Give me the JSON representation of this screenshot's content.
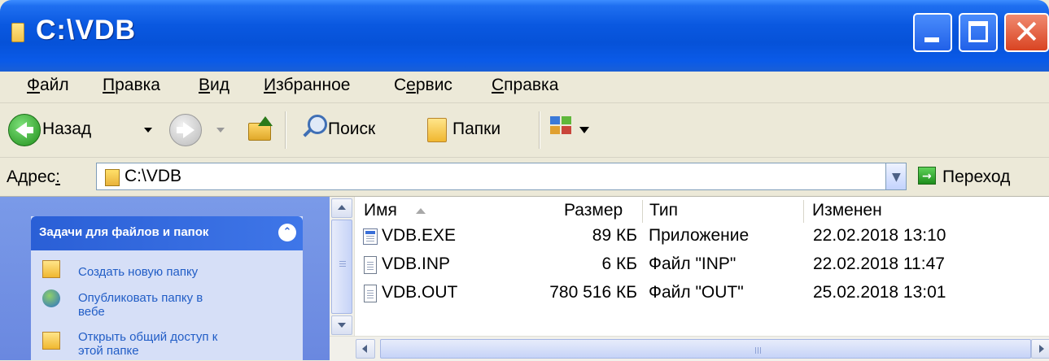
{
  "window": {
    "title": "C:\\VDB",
    "accent": "#0652d8",
    "close_color": "#d94422"
  },
  "menu": [
    {
      "accel": "Ф",
      "rest": "айл"
    },
    {
      "accel": "П",
      "rest": "равка"
    },
    {
      "accel": "В",
      "rest": "ид"
    },
    {
      "accel": "И",
      "rest": "збранное"
    },
    {
      "pre": "С",
      "accel": "е",
      "rest": "рвис"
    },
    {
      "accel": "С",
      "rest": "правка"
    }
  ],
  "toolbar": {
    "back_label": "Назад",
    "search_label": "Поиск",
    "folders_label": "Папки",
    "icons": [
      "back-arrow-icon",
      "forward-arrow-icon",
      "up-folder-icon",
      "search-icon",
      "folders-icon",
      "views-icon"
    ]
  },
  "address": {
    "label_main": "Адрес",
    "label_accel": ":",
    "value": "C:\\VDB",
    "go_label": "Переход"
  },
  "tasks": {
    "header": "Задачи для файлов и папок",
    "items": [
      {
        "text": "Создать новую папку",
        "icon": "new-folder-icon"
      },
      {
        "text": "Опубликовать папку в",
        "text2": "вебе",
        "icon": "publish-web-icon"
      },
      {
        "text": "Открыть общий доступ к",
        "text2": "этой папке",
        "icon": "share-folder-icon"
      }
    ]
  },
  "filelist": {
    "columns": {
      "name": "Имя",
      "size": "Размер",
      "type": "Тип",
      "modified": "Изменен"
    },
    "sort_column": "name",
    "rows": [
      {
        "name": "VDB.EXE",
        "size": "89 КБ",
        "type": "Приложение",
        "modified": "22.02.2018 13:10",
        "icon": "exe-file-icon"
      },
      {
        "name": "VDB.INP",
        "size": "6 КБ",
        "type": "Файл \"INP\"",
        "modified": "22.02.2018 11:47",
        "icon": "document-icon"
      },
      {
        "name": "VDB.OUT",
        "size": "780 516 КБ",
        "type": "Файл \"OUT\"",
        "modified": "25.02.2018 13:01",
        "icon": "document-icon"
      }
    ]
  }
}
